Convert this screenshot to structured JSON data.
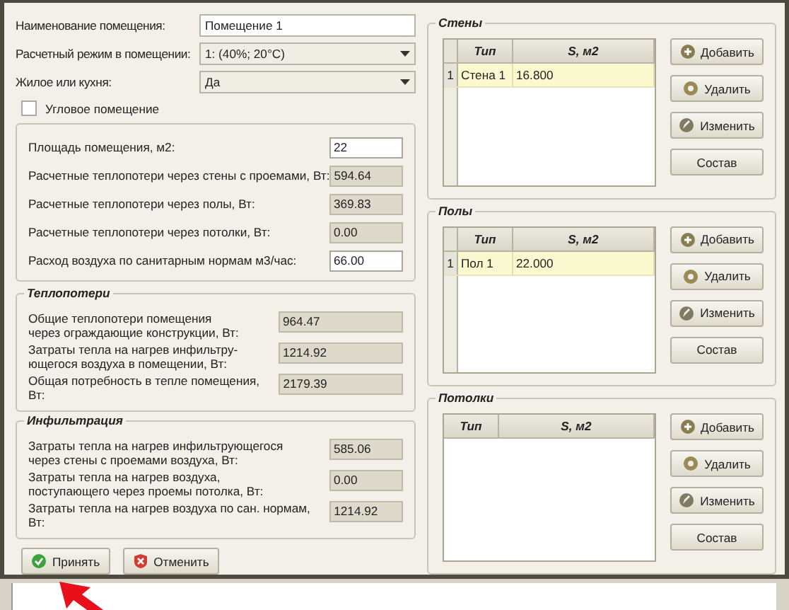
{
  "fields": [
    {
      "kind": "text",
      "label": "Наименование помещения:",
      "value": "Помещение 1"
    },
    {
      "kind": "combo",
      "label": "Расчетный режим в помещении:",
      "value": "1: (40%; 20°C)"
    },
    {
      "kind": "combo",
      "label": "Жилое или кухня:",
      "value": "Да"
    }
  ],
  "corner_room": {
    "label": "Угловое помещение",
    "checked": false
  },
  "params": [
    {
      "label": "Площадь помещения, м2:",
      "value": "22",
      "editable": true
    },
    {
      "label": "Расчетные теплопотери через стены с проемами, Вт:",
      "value": "594.64",
      "editable": false
    },
    {
      "label": "Расчетные теплопотери через полы, Вт:",
      "value": "369.83",
      "editable": false
    },
    {
      "label": "Расчетные теплопотери через потолки, Вт:",
      "value": "0.00",
      "editable": false
    },
    {
      "label": "Расход воздуха по санитарным нормам м3/час:",
      "value": "66.00",
      "editable": true
    }
  ],
  "groups": [
    {
      "title": "Теплопотери",
      "rows": [
        {
          "label": "Общие теплопотери помещения\nчерез ограждающие конструкции, Вт:",
          "value": "964.47"
        },
        {
          "label": "Затраты тепла на нагрев инфильтру-\nющегося воздуха в помещении, Вт:",
          "value": "1214.92"
        },
        {
          "label": "Общая потребность в  тепле помещения, Вт:",
          "value": "2179.39"
        }
      ]
    },
    {
      "title": "Инфильтрация",
      "rows": [
        {
          "label": "Затраты тепла на нагрев инфильтрующегося\nчерез стены с проемами воздуха, Вт:",
          "value": "585.06"
        },
        {
          "label": "Затраты тепла на нагрев воздуха,\nпоступающего через проемы потолка, Вт:",
          "value": "0.00"
        },
        {
          "label": "Затраты тепла на нагрев  воздуха по сан. нормам, Вт:",
          "value": "1214.92"
        }
      ]
    }
  ],
  "buttons": [
    {
      "kind": "accept",
      "label": "Принять"
    },
    {
      "kind": "cancel",
      "label": "Отменить"
    }
  ],
  "panels": [
    {
      "title": "Стены",
      "row_numbers": true,
      "columns": [
        "Тип",
        "S, м2"
      ],
      "rows": [
        {
          "number": "1",
          "type": "Стена 1",
          "area": "16.800"
        }
      ],
      "buttons": [
        {
          "kind": "add",
          "label": "Добавить"
        },
        {
          "kind": "delete",
          "label": "Удалить"
        },
        {
          "kind": "edit",
          "label": "Изменить"
        },
        {
          "kind": "plain",
          "label": "Состав"
        }
      ]
    },
    {
      "title": "Полы",
      "row_numbers": true,
      "columns": [
        "Тип",
        "S, м2"
      ],
      "rows": [
        {
          "number": "1",
          "type": "Пол 1",
          "area": "22.000"
        }
      ],
      "buttons": [
        {
          "kind": "add",
          "label": "Добавить"
        },
        {
          "kind": "delete",
          "label": "Удалить"
        },
        {
          "kind": "edit",
          "label": "Изменить"
        },
        {
          "kind": "plain",
          "label": "Состав"
        }
      ]
    },
    {
      "title": "Потолки",
      "row_numbers": false,
      "columns": [
        "Тип",
        "S, м2"
      ],
      "buttons": [
        {
          "kind": "add",
          "label": "Добавить"
        },
        {
          "kind": "delete",
          "label": "Удалить"
        },
        {
          "kind": "edit",
          "label": "Изменить"
        },
        {
          "kind": "plain",
          "label": "Состав"
        }
      ]
    }
  ]
}
